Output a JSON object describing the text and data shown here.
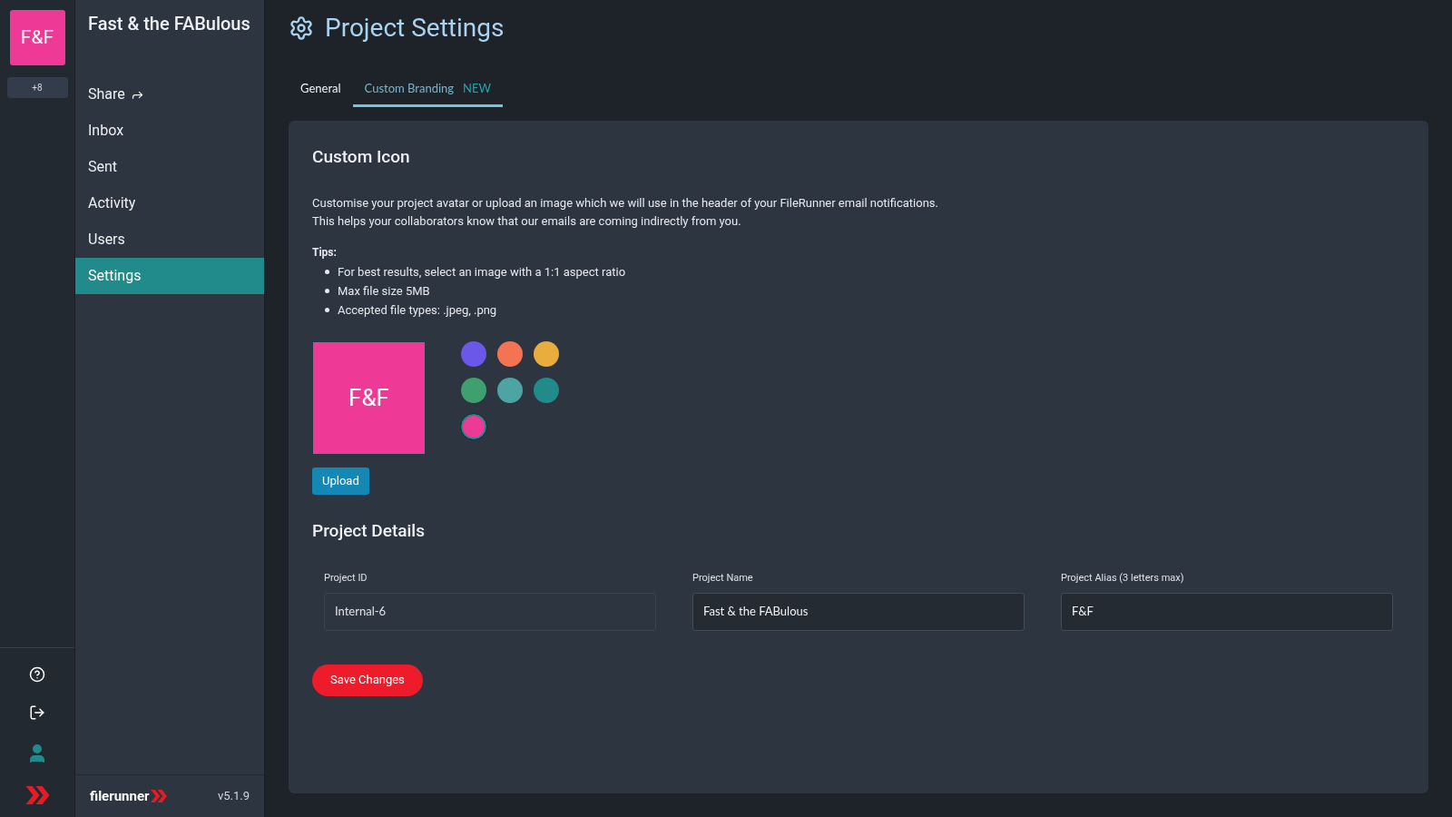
{
  "rail": {
    "project_avatar": {
      "text": "F&F",
      "color": "#ef3996"
    },
    "more_projects": "+8"
  },
  "sidebar": {
    "project_name": "Fast & the FABulous",
    "items": [
      {
        "label": "Share",
        "kind": "share",
        "selected": false
      },
      {
        "label": "Inbox",
        "kind": "plain",
        "selected": false
      },
      {
        "label": "Sent",
        "kind": "plain",
        "selected": false
      },
      {
        "label": "Activity",
        "kind": "plain",
        "selected": false
      },
      {
        "label": "Users",
        "kind": "plain",
        "selected": false
      },
      {
        "label": "Settings",
        "kind": "plain",
        "selected": true
      }
    ],
    "footer": {
      "brand": "filerunner",
      "version": "v5.1.9"
    }
  },
  "page": {
    "title": "Project Settings",
    "tabs": [
      {
        "label": "General",
        "selected": false
      },
      {
        "label": "Custom Branding",
        "badge": "NEW",
        "selected": true
      }
    ]
  },
  "custom_icon": {
    "heading": "Custom Icon",
    "description": [
      "Customise your project avatar or upload an image which we will use in the header of your FileRunner email notifications.",
      "This helps your collaborators know that our emails are coming indirectly from you."
    ],
    "tips_label": "Tips:",
    "tips": [
      "For best results, select an image with a 1:1 aspect ratio",
      "Max file size 5MB",
      "Accepted file types: .jpeg, .png"
    ],
    "preview_text": "F&F",
    "swatches": [
      {
        "color": "#6b57e8",
        "selected": false
      },
      {
        "color": "#f47352",
        "selected": false
      },
      {
        "color": "#e9ad3d",
        "selected": false
      },
      {
        "color": "#3fa06f",
        "selected": false
      },
      {
        "color": "#4ea3a3",
        "selected": false
      },
      {
        "color": "#218b8b",
        "selected": false
      },
      {
        "color": "#ef3996",
        "selected": true
      }
    ],
    "upload_button": "Upload"
  },
  "project_details": {
    "heading": "Project Details",
    "fields": [
      {
        "label": "Project ID",
        "value": "Internal-6",
        "disabled": true
      },
      {
        "label": "Project Name",
        "value": "Fast & the FABulous",
        "disabled": false
      },
      {
        "label": "Project Alias (3 letters max)",
        "value": "F&F",
        "disabled": false
      }
    ],
    "save_button": "Save Changes"
  }
}
